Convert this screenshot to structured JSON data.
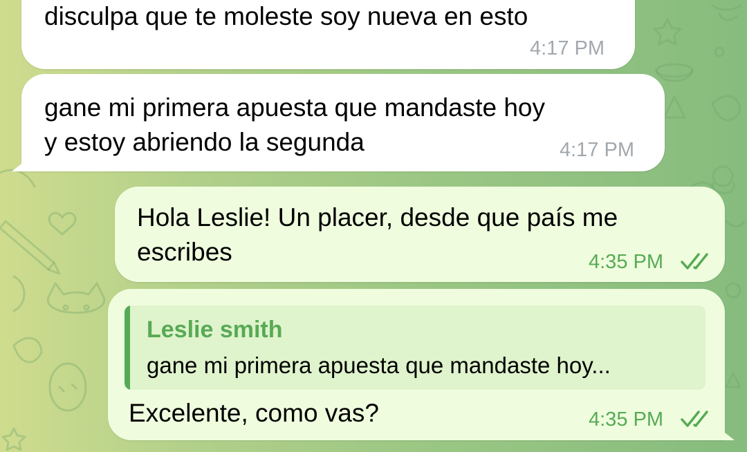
{
  "colors": {
    "incoming_bubble": "#ffffff",
    "outgoing_bubble": "#effdde",
    "accent_green": "#57aa55",
    "incoming_time": "#a2a8ad"
  },
  "messages": [
    {
      "direction": "incoming",
      "lines": [
        "disculpa que te moleste soy nueva en esto"
      ],
      "time": "4:17 PM"
    },
    {
      "direction": "incoming",
      "lines": [
        "gane mi primera apuesta que mandaste hoy",
        "y estoy abriendo la segunda"
      ],
      "time": "4:17 PM"
    },
    {
      "direction": "outgoing",
      "lines": [
        "Hola Leslie! Un placer, desde que país me",
        "escribes"
      ],
      "time": "4:35 PM",
      "status_icon": "double-check-icon"
    },
    {
      "direction": "outgoing",
      "reply_to": {
        "name": "Leslie smith",
        "snippet": "gane mi primera apuesta que mandaste hoy..."
      },
      "lines": [
        "Excelente, como vas?"
      ],
      "time": "4:35 PM",
      "status_icon": "double-check-icon"
    }
  ]
}
